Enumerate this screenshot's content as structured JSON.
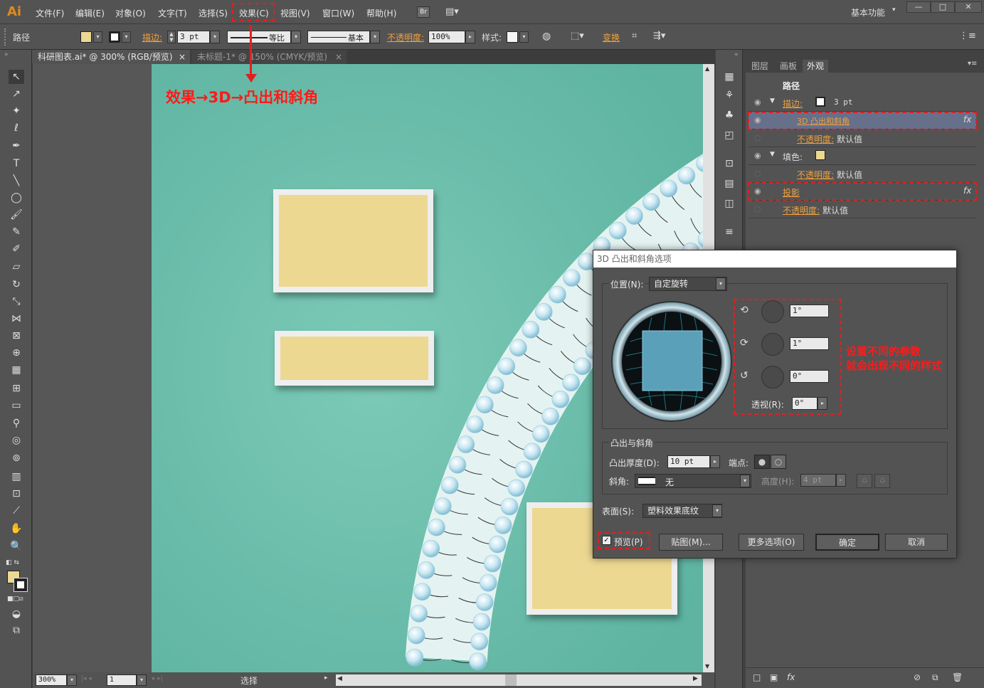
{
  "app": {
    "logo": "Ai",
    "workspace": "基本功能"
  },
  "menu": [
    "文件(F)",
    "编辑(E)",
    "对象(O)",
    "文字(T)",
    "选择(S)",
    "效果(C)",
    "视图(V)",
    "窗口(W)",
    "帮助(H)"
  ],
  "br_badge": "Br",
  "window_controls": [
    "—",
    "□",
    "✕"
  ],
  "control_bar": {
    "object_type": "路径",
    "stroke_label": "描边:",
    "stroke_value": "3 pt",
    "profile_label": "等比",
    "brush_label": "基本",
    "opacity_label": "不透明度:",
    "opacity_value": "100%",
    "style_label": "样式:",
    "transform_label": "变换"
  },
  "tabs": [
    {
      "label": "科研图表.ai* @ 300% (RGB/预览)",
      "close": "×",
      "active": true
    },
    {
      "label": "未标题-1* @ 150% (CMYK/预览)",
      "close": "×",
      "active": false
    }
  ],
  "annotation_top": "效果→3D→凸出和斜角",
  "annotation_right_1": "设置不同的参数",
  "annotation_right_2": "就会出现不同的样式",
  "status": {
    "zoom": "300%",
    "page": "1",
    "tool": "选择"
  },
  "appearance_panel": {
    "tabs": [
      "图层",
      "画板",
      "外观"
    ],
    "header": "路径",
    "rows": [
      {
        "label": "描边:",
        "value": "3 pt",
        "type": "stroke"
      },
      {
        "label": "3D 凸出和斜角",
        "fx": "fx",
        "type": "effect"
      },
      {
        "label": "不透明度:",
        "value": "默认值",
        "type": "sub"
      },
      {
        "label": "填色:",
        "type": "fill"
      },
      {
        "label": "不透明度:",
        "value": "默认值",
        "type": "sub"
      },
      {
        "label": "投影",
        "fx": "fx",
        "type": "effect2"
      },
      {
        "label": "不透明度:",
        "value": "默认值",
        "type": "sub2"
      }
    ],
    "bottom_fx": "fx"
  },
  "dialog": {
    "title": "3D 凸出和斜角选项",
    "position_label": "位置(N):",
    "position_value": "自定旋转",
    "rot_x": "1°",
    "rot_y": "1°",
    "rot_z": "0°",
    "perspective_label": "透视(R):",
    "perspective_value": "0°",
    "extrude_group": "凸出与斜角",
    "depth_label": "凸出厚度(D):",
    "depth_value": "10 pt",
    "cap_label": "端点:",
    "bevel_label": "斜角:",
    "bevel_value": "无",
    "height_label": "高度(H):",
    "height_value": "4 pt",
    "surface_label": "表面(S):",
    "surface_value": "塑料效果底纹",
    "preview_label": "预览(P)",
    "preview_checked": true,
    "map_button": "贴图(M)...",
    "more_button": "更多选项(O)",
    "ok_button": "确定",
    "cancel_button": "取消"
  },
  "colors": {
    "accent_orange": "#f0a13c",
    "annotation_red": "#e02020",
    "canvas_teal": "#6ec0ae",
    "card_fill": "#ecd891"
  }
}
